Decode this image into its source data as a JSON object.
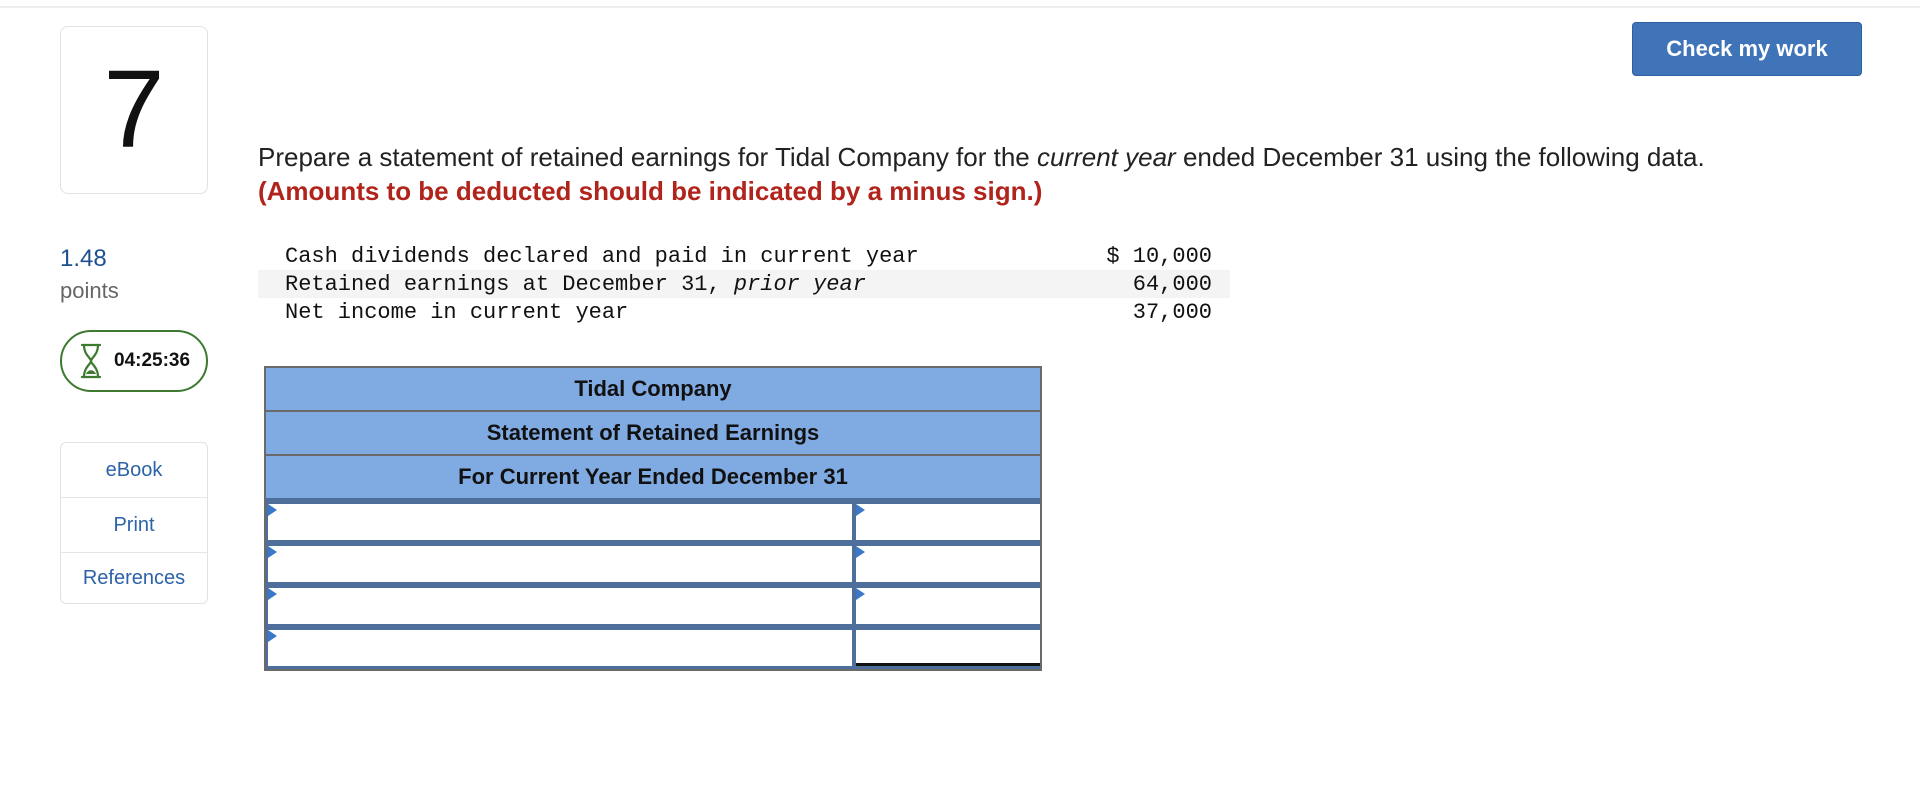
{
  "question": {
    "number": "7",
    "points_value": "1.48",
    "points_label": "points",
    "timer": "04:25:36"
  },
  "side_links": [
    {
      "label": "eBook"
    },
    {
      "label": "Print"
    },
    {
      "label": "References"
    }
  ],
  "check_button": {
    "label": "Check my work"
  },
  "prompt": {
    "before": "Prepare a statement of retained earnings for Tidal Company for the ",
    "italic": "current year",
    "after": " ended December 31 using the following data.",
    "instruction": "(Amounts to be deducted should be indicated by a minus sign.)"
  },
  "data_rows": [
    {
      "label": "Cash dividends declared and paid in current year",
      "label_italic": "",
      "value": "$ 10,000"
    },
    {
      "label": "Retained earnings at December 31, ",
      "label_italic": "prior year",
      "value": "64,000"
    },
    {
      "label": "Net income in current year",
      "label_italic": "",
      "value": "37,000"
    }
  ],
  "statement": {
    "company": "Tidal Company",
    "title": "Statement of Retained Earnings",
    "period": "For Current Year Ended December 31",
    "rows": [
      {
        "label": "",
        "amount": ""
      },
      {
        "label": "",
        "amount": ""
      },
      {
        "label": "",
        "amount": ""
      },
      {
        "label": "",
        "amount": ""
      }
    ]
  },
  "colors": {
    "header_fill": "#80aae2",
    "button": "#3f74b9",
    "instruction_red": "#b1241c",
    "timer_green": "#3d7a2f",
    "link_blue": "#2c63a8"
  },
  "icons": {
    "timer": "hourglass-icon",
    "input_marker": "input-marker-icon"
  }
}
